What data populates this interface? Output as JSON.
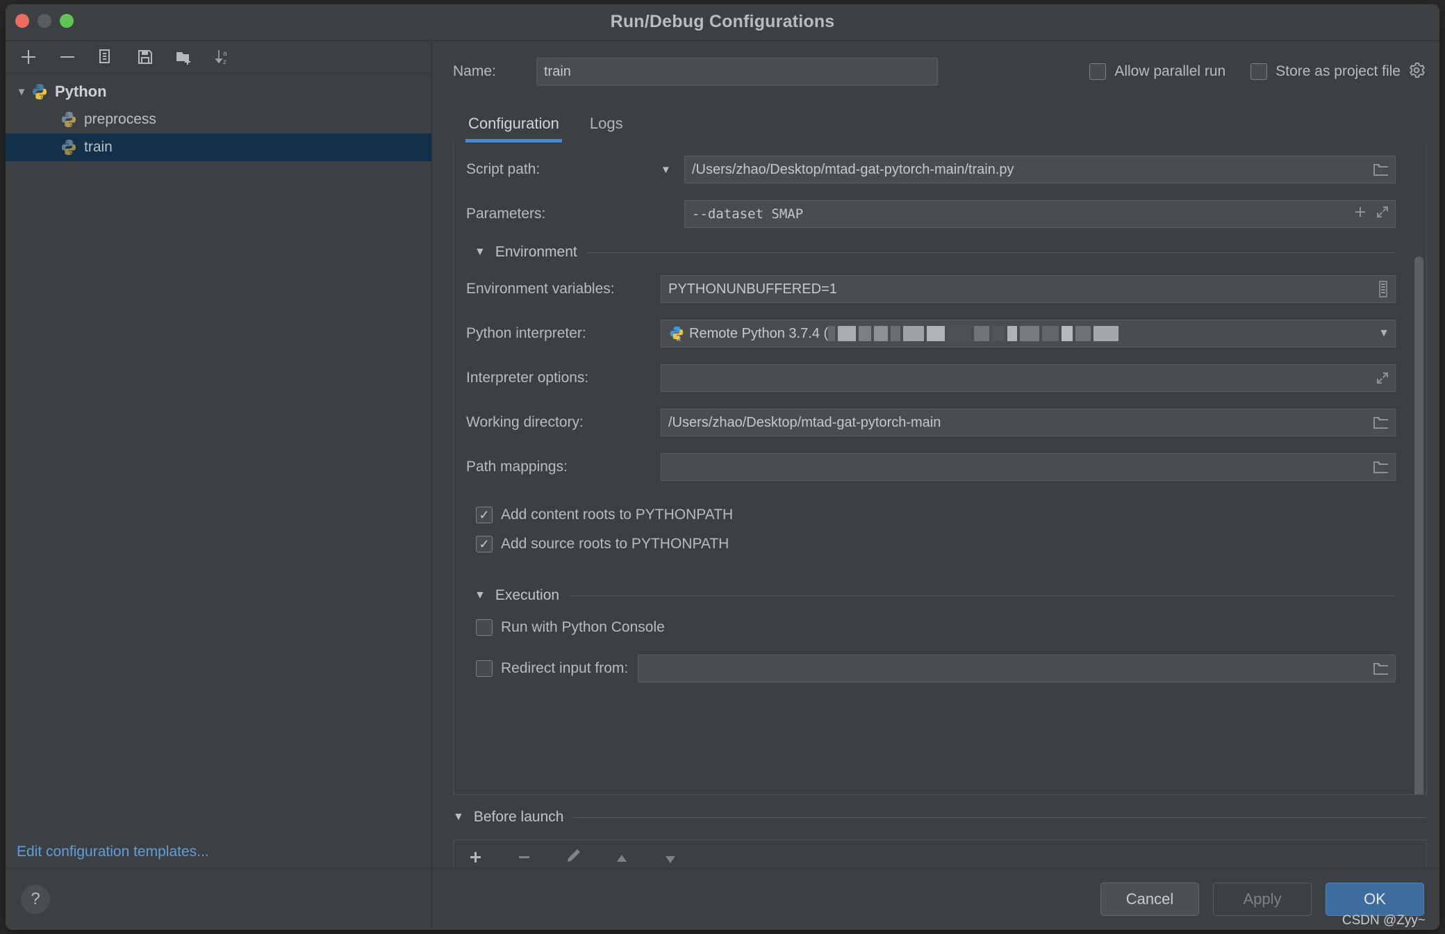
{
  "window": {
    "title": "Run/Debug Configurations",
    "traffic_lights": [
      "close",
      "minimize",
      "zoom"
    ]
  },
  "left_panel": {
    "toolbar": [
      {
        "name": "add-configuration-button",
        "icon": "plus-icon"
      },
      {
        "name": "remove-configuration-button",
        "icon": "minus-icon"
      },
      {
        "name": "copy-configuration-button",
        "icon": "copy-icon"
      },
      {
        "name": "save-configuration-button",
        "icon": "save-icon"
      },
      {
        "name": "new-folder-button",
        "icon": "new-folder-icon"
      },
      {
        "name": "sort-configurations-button",
        "icon": "sort-az-icon"
      }
    ],
    "tree": [
      {
        "label": "Python",
        "level": 0,
        "expanded": true,
        "selected": false,
        "icon": "python-icon"
      },
      {
        "label": "preprocess",
        "level": 1,
        "expanded": false,
        "selected": false,
        "icon": "python-icon"
      },
      {
        "label": "train",
        "level": 1,
        "expanded": false,
        "selected": true,
        "icon": "python-icon"
      }
    ],
    "edit_templates_link": "Edit configuration templates...",
    "help_button": "?"
  },
  "header": {
    "name_label": "Name:",
    "name_value": "train",
    "allow_parallel_run": {
      "label": "Allow parallel run",
      "checked": false
    },
    "store_as_project_file": {
      "label": "Store as project file",
      "checked": false
    }
  },
  "tabs": [
    {
      "label": "Configuration",
      "active": true
    },
    {
      "label": "Logs",
      "active": false
    }
  ],
  "form": {
    "script_path": {
      "label": "Script path:",
      "value": "/Users/zhao/Desktop/mtad-gat-pytorch-main/train.py"
    },
    "parameters": {
      "label": "Parameters:",
      "value": "--dataset SMAP"
    },
    "environment_section": {
      "title": "Environment",
      "expanded": true
    },
    "environment_variables": {
      "label": "Environment variables:",
      "value": "PYTHONUNBUFFERED=1"
    },
    "python_interpreter": {
      "label": "Python interpreter:",
      "value": "Remote Python 3.7.4 (",
      "redacted": true
    },
    "interpreter_options": {
      "label": "Interpreter options:",
      "value": ""
    },
    "working_directory": {
      "label": "Working directory:",
      "value": "/Users/zhao/Desktop/mtad-gat-pytorch-main"
    },
    "path_mappings": {
      "label": "Path mappings:",
      "value": ""
    },
    "add_content_roots": {
      "label": "Add content roots to PYTHONPATH",
      "checked": true
    },
    "add_source_roots": {
      "label": "Add source roots to PYTHONPATH",
      "checked": true
    },
    "execution_section": {
      "title": "Execution",
      "expanded": true
    },
    "run_with_python_console": {
      "label": "Run with Python Console",
      "checked": false
    },
    "redirect_input_from": {
      "label": "Redirect input from:",
      "checked": false,
      "value": ""
    },
    "before_launch_section": {
      "title": "Before launch",
      "expanded": true,
      "toolbar": [
        {
          "name": "before-launch-add-button",
          "icon": "plus-icon"
        },
        {
          "name": "before-launch-remove-button",
          "icon": "minus-icon"
        },
        {
          "name": "before-launch-edit-button",
          "icon": "pencil-icon"
        },
        {
          "name": "before-launch-move-up-button",
          "icon": "arrow-up-icon"
        },
        {
          "name": "before-launch-move-down-button",
          "icon": "arrow-down-icon"
        }
      ]
    }
  },
  "footer": {
    "cancel": "Cancel",
    "apply": "Apply",
    "ok": "OK",
    "apply_enabled": false,
    "watermark": "CSDN @Zyy~"
  },
  "colors": {
    "window_bg": "#3c4043",
    "field_bg": "#494d50",
    "accent_blue": "#4a88c7",
    "selection_blue": "#123049",
    "link_blue": "#5c9fe0",
    "ok_button": "#3d6c9e",
    "text_primary": "#b9bcbe"
  }
}
